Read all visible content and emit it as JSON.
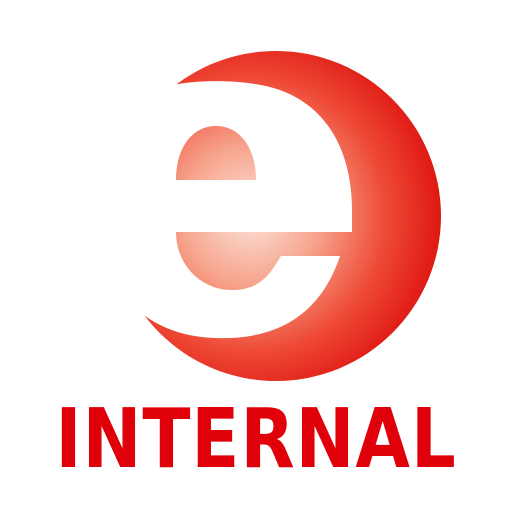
{
  "logo": {
    "icon": "e-letter-globe-icon",
    "wordmark": "INTERNAL",
    "colors": {
      "brand_red": "#e0000a",
      "sphere_highlight": "#fbe3da",
      "sphere_mid": "#f0644a",
      "sphere_edge": "#de1410",
      "background": "#ffffff"
    }
  }
}
